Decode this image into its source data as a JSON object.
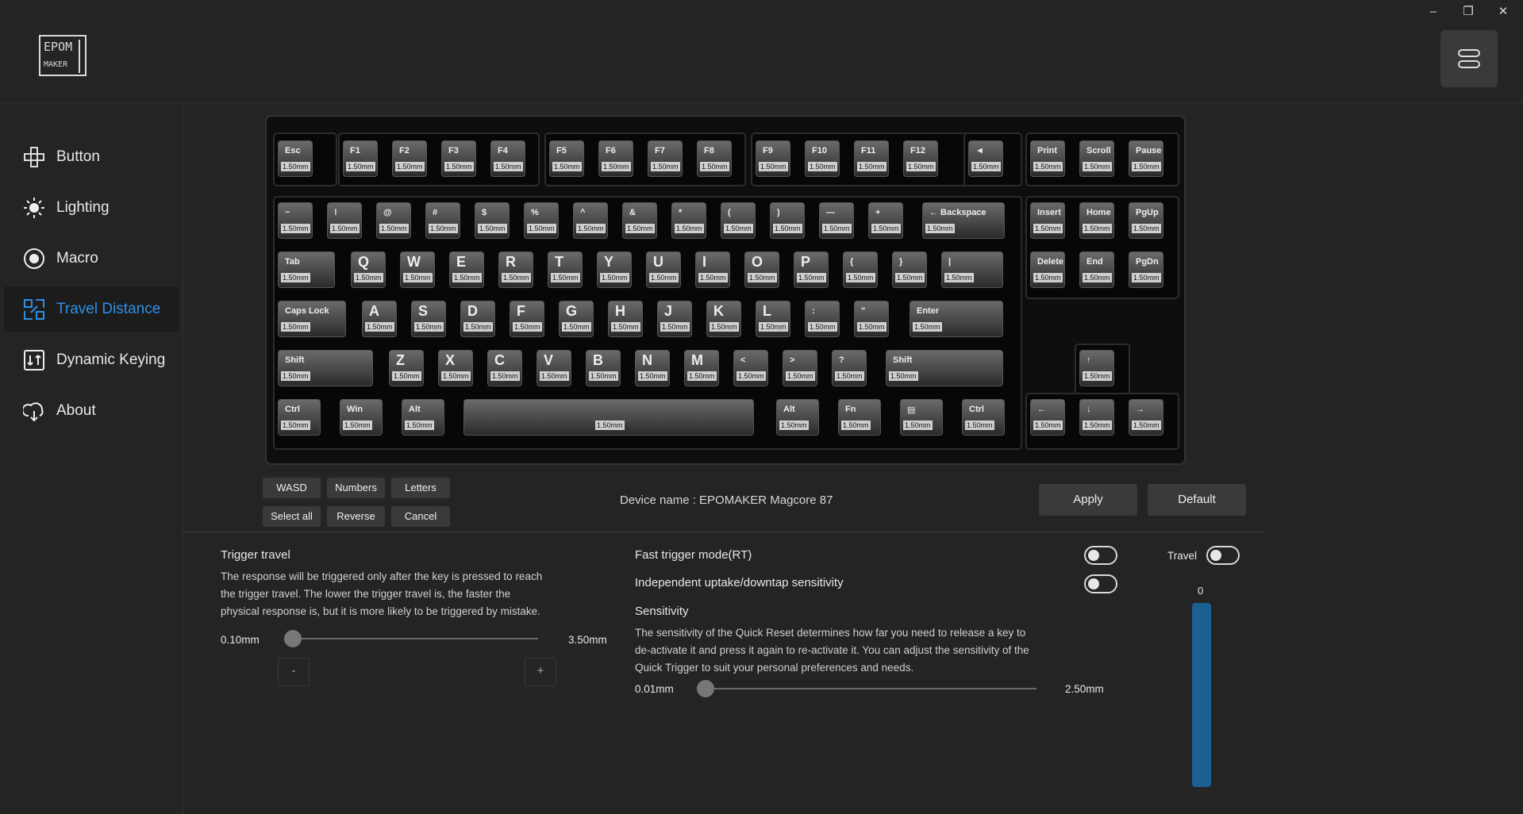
{
  "window": {
    "minimize": "–",
    "restore": "❐",
    "close": "✕"
  },
  "logo": {
    "line1": "EPOM",
    "line2": "MAKER"
  },
  "sidebar": {
    "items": [
      {
        "label": "Button",
        "icon": "gamepad-icon"
      },
      {
        "label": "Lighting",
        "icon": "sun-icon"
      },
      {
        "label": "Macro",
        "icon": "record-icon"
      },
      {
        "label": "Travel Distance",
        "icon": "travel-icon",
        "active": true
      },
      {
        "label": "Dynamic Keying",
        "icon": "dynamic-keying-icon"
      },
      {
        "label": "About",
        "icon": "about-icon"
      }
    ],
    "active_color": "#2f8fe6"
  },
  "keyboard": {
    "rows": [
      [
        "Esc",
        "F1",
        "F2",
        "F3",
        "F4",
        "F5",
        "F6",
        "F7",
        "F8",
        "F9",
        "F10",
        "F11",
        "F12",
        "◄",
        "Print",
        "Scroll",
        "Pause"
      ],
      [
        "~",
        "!",
        "@",
        "#",
        "$",
        "%",
        "^",
        "&",
        "*",
        "(",
        ")",
        "—",
        "+",
        "← Backspace",
        "Insert",
        "Home",
        "PgUp"
      ],
      [
        "Tab",
        "Q",
        "W",
        "E",
        "R",
        "T",
        "Y",
        "U",
        "I",
        "O",
        "P",
        "{",
        "}",
        "|",
        "Delete",
        "End",
        "PgDn"
      ],
      [
        "Caps Lock",
        "A",
        "S",
        "D",
        "F",
        "G",
        "H",
        "J",
        "K",
        "L",
        ":",
        "\"",
        "Enter"
      ],
      [
        "Shift",
        "Z",
        "X",
        "C",
        "V",
        "B",
        "N",
        "M",
        "<",
        ">",
        "?",
        "Shift",
        "↑"
      ],
      [
        "Ctrl",
        "Win",
        "Alt",
        "",
        "Alt",
        "Fn",
        "▤",
        "Ctrl",
        "←",
        "↓",
        "→"
      ]
    ],
    "travel": "1.50mm"
  },
  "selection_buttons": {
    "wasd": "WASD",
    "numbers": "Numbers",
    "letters": "Letters",
    "select_all": "Select all",
    "reverse": "Reverse",
    "cancel": "Cancel"
  },
  "device": {
    "label": "Device name : EPOMAKER Magcore 87"
  },
  "actions": {
    "apply": "Apply",
    "default": "Default"
  },
  "trigger": {
    "title": "Trigger travel",
    "description_1": "The response will be triggered only after the key is pressed to reach",
    "description_2": "the trigger travel. The lower the trigger travel is, the faster the",
    "description_3": "physical response is, but it is more likely to be triggered by mistake.",
    "min": "0.10mm",
    "max": "3.50mm",
    "value_fraction": 0.0,
    "minus": "-",
    "plus": "+"
  },
  "rt": {
    "fast_trigger": "Fast trigger mode(RT)",
    "independent": "Independent uptake/downtap sensitivity",
    "sensitivity_title": "Sensitivity",
    "description_1": "The sensitivity of the Quick Reset determines how far you need to release a key to",
    "description_2": "de-activate it and press it again to re-activate it. You can adjust the sensitivity of the",
    "description_3": "Quick Trigger to suit your personal preferences and needs.",
    "min": "0.01mm",
    "max": "2.50mm",
    "value_fraction": 0.0
  },
  "travel_panel": {
    "label": "Travel",
    "value": "0"
  }
}
